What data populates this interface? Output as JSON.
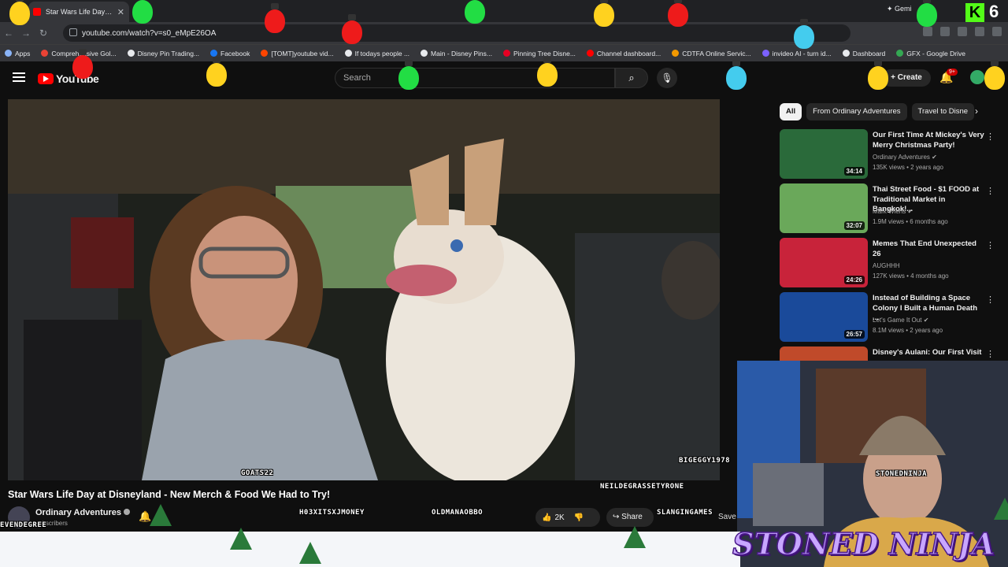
{
  "browser": {
    "tab_title": "Star Wars Life Day at D",
    "gemini_label": "Gemi",
    "kick_count": "6",
    "url": "youtube.com/watch?v=s0_eMpE26OA",
    "bookmarks": [
      {
        "label": "Apps",
        "color": "#8ab4f8"
      },
      {
        "label": "Comprehensive Gol...",
        "color": "#ea4335"
      },
      {
        "label": "Disney Pin Trading...",
        "color": "#e8eaed"
      },
      {
        "label": "Facebook",
        "color": "#1877f2"
      },
      {
        "label": "[TOMT]youtube vid...",
        "color": "#ff4500"
      },
      {
        "label": "If todays people ...",
        "color": "#e8eaed"
      },
      {
        "label": "Main - Disney Pins...",
        "color": "#e8eaed"
      },
      {
        "label": "Pinning Tree Disne...",
        "color": "#e60023"
      },
      {
        "label": "Channel dashboard...",
        "color": "#ff0000"
      },
      {
        "label": "CDTFA Online Servic...",
        "color": "#f29900"
      },
      {
        "label": "invideo AI - turn id...",
        "color": "#7b61ff"
      },
      {
        "label": "Dashboard",
        "color": "#e8eaed"
      },
      {
        "label": "GFX - Google Drive",
        "color": "#34a853"
      }
    ]
  },
  "youtube": {
    "logo": "YouTube",
    "search_placeholder": "Search",
    "create_label": "Create",
    "notif_badge": "9+",
    "video": {
      "title": "Star Wars Life Day at Disneyland - New Merch & Food We Had to Try!",
      "channel": "Ordinary Adventures",
      "subscribers": "subscribers",
      "likes": "2K",
      "share": "Share",
      "save": "Save"
    },
    "chips": [
      "All",
      "From Ordinary Adventures",
      "Travel to Disne"
    ],
    "recommendations": [
      {
        "title": "Our First Time At Mickey's Very Merry Christmas Party!",
        "channel": "Ordinary Adventures",
        "meta": "135K views • 2 years ago",
        "duration": "34:14",
        "thumb_color": "#2a6a3a",
        "verified": true
      },
      {
        "title": "Thai Street Food - $1 FOOD at Traditional Market in Bangkok!...",
        "channel": "Mark Wiens",
        "meta": "1.9M views • 6 months ago",
        "duration": "32:07",
        "thumb_color": "#6aa85a",
        "verified": true
      },
      {
        "title": "Memes That End Unexpected 26",
        "channel": "AUGHHH",
        "meta": "127K views • 4 months ago",
        "duration": "24:26",
        "thumb_color": "#c8233a",
        "verified": false
      },
      {
        "title": "Instead of Building a Space Colony I Built a Human Death ...",
        "channel": "Let's Game It Out",
        "meta": "8.1M views • 2 years ago",
        "duration": "26:57",
        "thumb_color": "#1a4a9a",
        "verified": true
      },
      {
        "title": "Disney's Aulani: Our First Visit",
        "channel": "",
        "meta": "",
        "duration": "",
        "thumb_color": "#c04a2a",
        "verified": false
      }
    ]
  },
  "overlay": {
    "viewers": [
      {
        "name": "GOATS22"
      },
      {
        "name": "BIGEGGY1978"
      },
      {
        "name": "NEILDEGRASSETYRONE"
      },
      {
        "name": "STONEDNINJA"
      },
      {
        "name": "H03XITSXJMONEY"
      },
      {
        "name": "OLDMANAOBBO"
      },
      {
        "name": "SLANGINGAMES"
      },
      {
        "name": "EVENDEGREE"
      }
    ],
    "brand": "STONED NINJA",
    "bulb_colors": [
      "#ffd21f",
      "#22dd44",
      "#ee1b1b",
      "#44ccee"
    ]
  }
}
